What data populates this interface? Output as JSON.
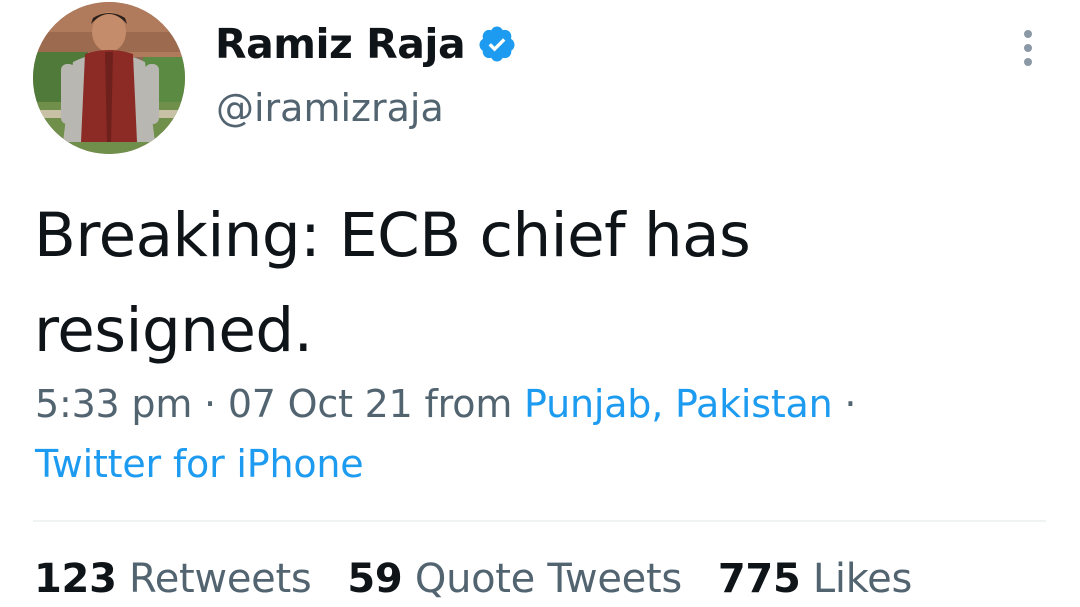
{
  "author": {
    "display_name": "Ramiz Raja",
    "handle": "@iramizraja",
    "verified": true
  },
  "tweet": {
    "text": "Breaking: ECB chief has resigned.",
    "time": "5:33 pm",
    "separator": "·",
    "date": "07 Oct 21",
    "from_label": "from",
    "location": "Punjab, Pakistan",
    "source": "Twitter for iPhone"
  },
  "stats": [
    {
      "count": "123",
      "label": "Retweets"
    },
    {
      "count": "59",
      "label": "Quote Tweets"
    },
    {
      "count": "775",
      "label": "Likes"
    }
  ],
  "icons": {
    "verified": "verified-badge-icon",
    "more": "more-vertical-icon"
  },
  "colors": {
    "accent": "#1d9bf0",
    "secondary_text": "#536471",
    "primary_text": "#0f1419",
    "divider": "#eff3f4"
  }
}
